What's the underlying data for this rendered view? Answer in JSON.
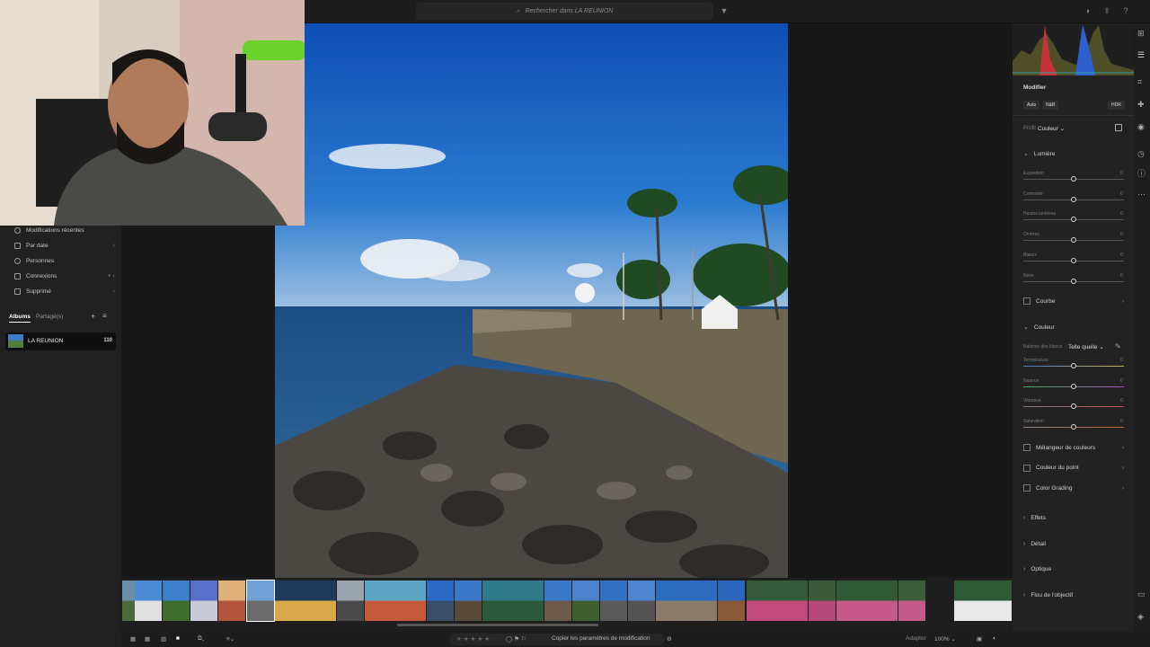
{
  "topbar": {
    "search_placeholder": "Rechercher dans LA REUNION",
    "icons": [
      "search-icon",
      "filter-icon",
      "bell-icon",
      "share-icon",
      "help-icon"
    ]
  },
  "left_panel": {
    "items": [
      {
        "label": "Modifications récentes",
        "icon": "clock-icon",
        "arrow": ""
      },
      {
        "label": "Par date",
        "icon": "calendar-icon",
        "arrow": "‹"
      },
      {
        "label": "Personnes",
        "icon": "person-icon",
        "arrow": ""
      },
      {
        "label": "Connexions",
        "icon": "connections-icon",
        "arrow": "+ ‹"
      },
      {
        "label": "Supprimé",
        "icon": "trash-icon",
        "arrow": "›"
      }
    ],
    "tabs": {
      "albums": "Albums",
      "shared": "Partagé(s)"
    },
    "album": {
      "name": "LA REUNION",
      "count": "110"
    }
  },
  "right_panel": {
    "title": "Modifier",
    "buttons": {
      "auto": "Auto",
      "bw": "N&B",
      "hdr": "HDR"
    },
    "profile": {
      "label": "Profil",
      "value": "Couleur"
    },
    "lumiere": {
      "title": "Lumière",
      "sliders": [
        {
          "label": "Exposition",
          "value": "0"
        },
        {
          "label": "Contraste",
          "value": "0"
        },
        {
          "label": "Hautes lumières",
          "value": "0"
        },
        {
          "label": "Ombres",
          "value": "0"
        },
        {
          "label": "Blancs",
          "value": "0"
        },
        {
          "label": "Noirs",
          "value": "0"
        }
      ]
    },
    "courbe": "Courbe",
    "couleur": {
      "title": "Couleur",
      "wb_label": "Balance des blancs",
      "wb_value": "Telle quelle",
      "sliders": [
        {
          "label": "Température",
          "value": "0"
        },
        {
          "label": "Nuance",
          "value": "0"
        },
        {
          "label": "Vibrance",
          "value": "0"
        },
        {
          "label": "Saturation",
          "value": "0"
        }
      ]
    },
    "subsections": [
      "Mélangeur de couleurs",
      "Couleur du point",
      "Color Grading"
    ],
    "collapsed": [
      "Effets",
      "Détail",
      "Optique",
      "Flou de l'objectif"
    ]
  },
  "bottombar": {
    "copy_label": "Copier les paramètres de modification",
    "fit_label": "Adapter",
    "zoom": "100%"
  },
  "colors": {
    "accent": "#1473e6",
    "panel": "#222222",
    "bg": "#181818"
  }
}
